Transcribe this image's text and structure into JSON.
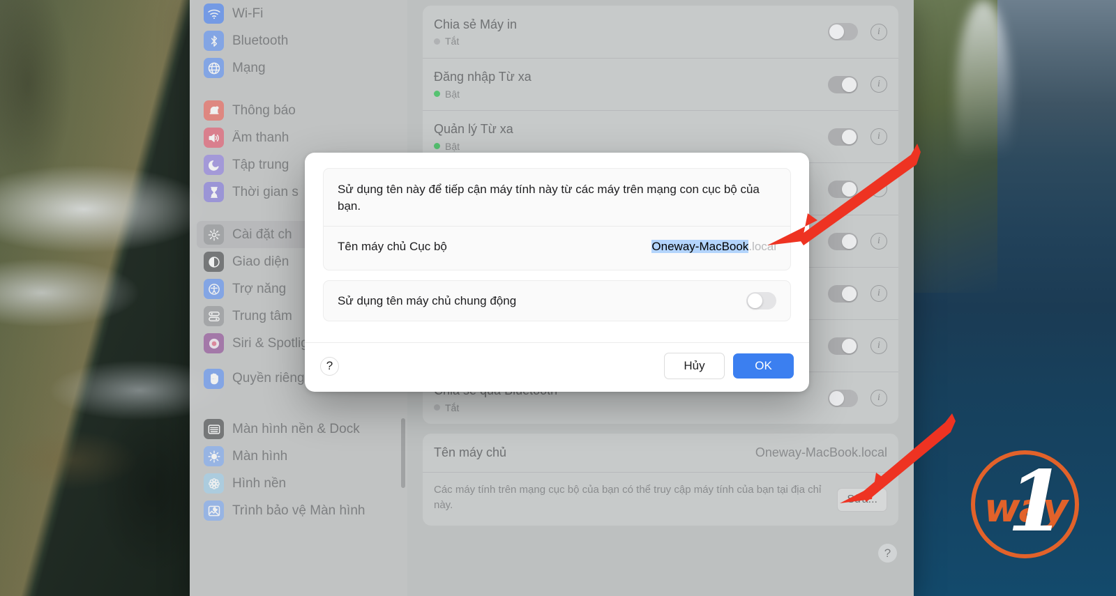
{
  "sidebar": {
    "items": [
      {
        "label": "Wi-Fi",
        "icon": "wifi-icon",
        "color": "#5b8def",
        "glyph": "wifi"
      },
      {
        "label": "Bluetooth",
        "icon": "bluetooth-icon",
        "color": "#6f9bf0",
        "glyph": "bt"
      },
      {
        "label": "Mạng",
        "icon": "network-icon",
        "color": "#6f9bf0",
        "glyph": "globe"
      },
      {
        "gap": true
      },
      {
        "label": "Thông báo",
        "icon": "notifications-icon",
        "color": "#e8736a",
        "glyph": "bell"
      },
      {
        "label": "Âm thanh",
        "icon": "sound-icon",
        "color": "#e2697c",
        "glyph": "speaker"
      },
      {
        "label": "Tập trung",
        "icon": "focus-icon",
        "color": "#9a8ce0",
        "glyph": "moon"
      },
      {
        "label": "Thời gian s",
        "icon": "screen-time-icon",
        "color": "#8f86dd",
        "glyph": "hourglass"
      },
      {
        "gap": true
      },
      {
        "label": "Cài đặt ch",
        "icon": "general-icon",
        "color": "#9b9d9f",
        "glyph": "gear",
        "selected": true
      },
      {
        "label": "Giao diện",
        "icon": "appearance-icon",
        "color": "#5c5e60",
        "glyph": "contrast"
      },
      {
        "label": "Trợ năng",
        "icon": "accessibility-icon",
        "color": "#6f9bf0",
        "glyph": "access"
      },
      {
        "label": "Trung tâm",
        "icon": "control-center-icon",
        "color": "#9b9d9f",
        "glyph": "sliders"
      },
      {
        "label": "Siri & Spotlight",
        "icon": "siri-icon",
        "color": "#9a5fa0",
        "glyph": "siri"
      },
      {
        "label": "Quyền riêng tư & Bảo mật",
        "icon": "privacy-icon",
        "color": "#6f9bf0",
        "glyph": "hand",
        "wrap": true
      },
      {
        "gap": true
      },
      {
        "label": "Màn hình nền & Dock",
        "icon": "desktop-dock-icon",
        "color": "#5c5e60",
        "glyph": "dock"
      },
      {
        "label": "Màn hình",
        "icon": "displays-icon",
        "color": "#8ab0ee",
        "glyph": "sun"
      },
      {
        "label": "Hình nền",
        "icon": "wallpaper-icon",
        "color": "#a6cfe8",
        "glyph": "flower"
      },
      {
        "label": "Trình bảo vệ Màn hình",
        "icon": "screensaver-icon",
        "color": "#8ab0ee",
        "glyph": "nightscape"
      }
    ]
  },
  "main": {
    "rows": [
      {
        "title": "Chia sẻ Máy in",
        "status": "Tắt",
        "on": false,
        "toggle_on": false
      },
      {
        "title": "Đăng nhập Từ xa",
        "status": "Bật",
        "on": true,
        "toggle_on": true
      },
      {
        "title": "Quản lý Từ xa",
        "status": "Bật",
        "on": true,
        "toggle_on": true
      },
      {
        "title": "",
        "status": "",
        "on": false,
        "toggle_on": true
      },
      {
        "title": "",
        "status": "",
        "on": false,
        "toggle_on": true
      },
      {
        "title": "",
        "status": "",
        "on": false,
        "toggle_on": true
      },
      {
        "title": "",
        "status": "",
        "on": false,
        "toggle_on": true
      },
      {
        "title": "Chia sẻ qua Bluetooth",
        "status": "Tắt",
        "on": false,
        "toggle_on": false
      }
    ],
    "hostname_label": "Tên máy chủ",
    "hostname_value": "Oneway-MacBook.local",
    "hostname_desc": "Các máy tính trên mạng cục bộ của bạn có thể truy cập máy tính của bạn tại địa chỉ này.",
    "edit_button": "Sửa...",
    "help_glyph": "?"
  },
  "dialog": {
    "description": "Sử dụng tên này để tiếp cận máy tính này từ các máy trên mạng con cục bộ của bạn.",
    "hostname_label": "Tên máy chủ Cục bộ",
    "hostname_selected": "Oneway-MacBook",
    "hostname_suffix": ".local",
    "dynamic_label": "Sử dụng tên máy chủ chung động",
    "dynamic_on": false,
    "help_glyph": "?",
    "cancel_label": "Hủy",
    "ok_label": "OK",
    "accent_color": "#3b7ff0",
    "selection_color": "#b3d4fc"
  },
  "annotations": {
    "arrow_color": "#ee3322",
    "arrow_top_target": "hostname-field-in-dialog",
    "arrow_bottom_target": "edit-button"
  },
  "watermark": {
    "word": "way",
    "numeral": "1",
    "color": "#e2622a"
  }
}
